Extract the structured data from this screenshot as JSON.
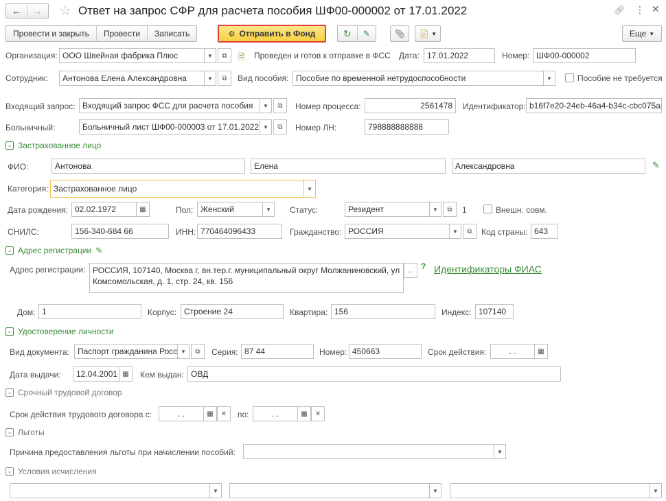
{
  "window": {
    "title": "Ответ на запрос СФР для расчета пособия ШФ00-000002 от 17.01.2022"
  },
  "toolbar": {
    "post_close": "Провести и закрыть",
    "post": "Провести",
    "write": "Записать",
    "send": "Отправить в Фонд",
    "more": "Еще"
  },
  "header": {
    "org_label": "Организация:",
    "org_value": "ООО Швейная фабрика Плюс",
    "posted_status": "Проведен и готов к отправке в ФСС",
    "date_label": "Дата:",
    "date_value": "17.01.2022",
    "number_label": "Номер:",
    "number_value": "ШФ00-000002",
    "employee_label": "Сотрудник:",
    "employee_value": "Антонова Елена Александровна",
    "benefit_type_label": "Вид пособия:",
    "benefit_type_value": "Пособие по временной нетрудоспособности",
    "not_required_label": "Пособие не требуется",
    "incoming_label": "Входящий запрос:",
    "incoming_value": "Входящий запрос ФСС для расчета пособия",
    "process_label": "Номер процесса:",
    "process_value": "2561478",
    "id_label": "Идентификатор:",
    "id_value": "b16f7e20-24eb-46a4-b34c-cbc075a8",
    "sick_label": "Больничный:",
    "sick_value": "Больничный лист ШФ00-000003 от 17.01.2022",
    "ln_label": "Номер ЛН:",
    "ln_value": "798888888888"
  },
  "insured": {
    "title": "Застрахованное лицо",
    "fio_label": "ФИО:",
    "last_name": "Антонова",
    "first_name": "Елена",
    "middle_name": "Александровна",
    "category_label": "Категория:",
    "category_value": "Застрахованное лицо",
    "birth_label": "Дата рождения:",
    "birth_value": "02.02.1972",
    "sex_label": "Пол:",
    "sex_value": "Женский",
    "status_label": "Статус:",
    "status_value": "Резидент",
    "status_num": "1",
    "ext_label": "Внешн. совм.",
    "snils_label": "СНИЛС:",
    "snils_value": "156-340-684 66",
    "inn_label": "ИНН:",
    "inn_value": "770464096433",
    "citizenship_label": "Гражданство:",
    "citizenship_value": "РОССИЯ",
    "country_code_label": "Код страны:",
    "country_code_value": "643"
  },
  "address": {
    "title": "Адрес регистрации",
    "label": "Адрес регистрации:",
    "value": "РОССИЯ, 107140, Москва г, вн.тер.г. муниципальный округ Молжаниновский, ул Комсомольская, д. 1, стр. 24, кв. 156",
    "help": "?",
    "fias_link": "Идентификаторы ФИАС",
    "house_label": "Дом:",
    "house_value": "1",
    "building_label": "Корпус:",
    "building_value": "Строение 24",
    "apt_label": "Квартира:",
    "apt_value": "156",
    "index_label": "Индекс:",
    "index_value": "107140"
  },
  "identity": {
    "title": "Удостоверение личности",
    "doc_type_label": "Вид документа:",
    "doc_type_value": "Паспорт гражданина Росс",
    "series_label": "Серия:",
    "series_value": "87 44",
    "number_label": "Номер:",
    "number_value": "450663",
    "valid_label": "Срок действия:",
    "valid_value": ".  .",
    "issue_label": "Дата выдачи:",
    "issue_value": "12.04.2001",
    "issued_by_label": "Кем выдан:",
    "issued_by_value": "ОВД"
  },
  "contract": {
    "title": "Срочный трудовой договор",
    "from_label": "Срок действия трудового договора с:",
    "from_value": ".  .",
    "to_label": "по:",
    "to_value": ".  ."
  },
  "benefits": {
    "title": "Льготы",
    "reason_label": "Причина предоставления льготы при начислении пособий:",
    "reason_value": ""
  },
  "conditions": {
    "title": "Условия исчисления",
    "f1": "",
    "f2": "",
    "f3": ""
  },
  "colors": {
    "accent_green": "#3a8b3a",
    "send_button": "#f7cf3d",
    "send_border": "#e2403a"
  }
}
